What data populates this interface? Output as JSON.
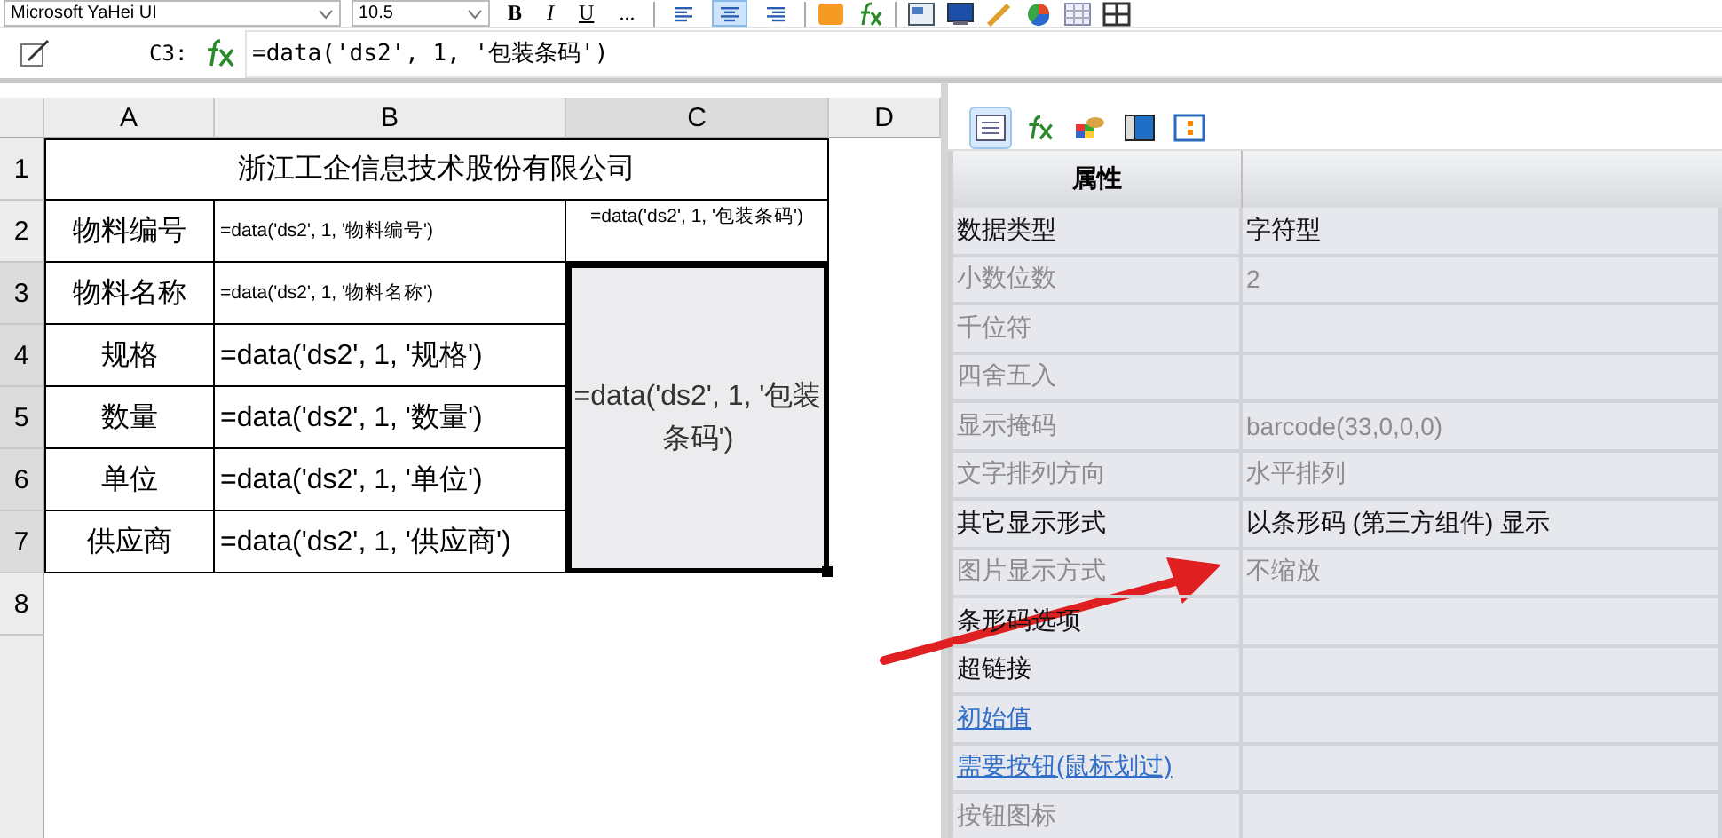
{
  "toolbar": {
    "font": "Microsoft YaHei UI",
    "size": "10.5",
    "format_buttons": [
      {
        "label": "B",
        "kind": "bold"
      },
      {
        "label": "I",
        "kind": "italic"
      },
      {
        "label": "U",
        "kind": "underline"
      },
      {
        "label": "...",
        "kind": "plain"
      }
    ],
    "alignments": [
      {
        "kind": "left",
        "selected": false
      },
      {
        "kind": "center",
        "selected": true
      },
      {
        "kind": "right",
        "selected": false
      }
    ]
  },
  "formula_bar": {
    "cell": "C3:",
    "formula": "=data('ds2', 1, '包装条码')"
  },
  "sheet": {
    "columns": [
      {
        "label": "A",
        "selected": false
      },
      {
        "label": "B",
        "selected": false
      },
      {
        "label": "C",
        "selected": true
      },
      {
        "label": "D",
        "selected": false
      }
    ],
    "rows": [
      {
        "label": "1",
        "selected": false
      },
      {
        "label": "2",
        "selected": false
      },
      {
        "label": "3",
        "selected": true
      },
      {
        "label": "4",
        "selected": true
      },
      {
        "label": "5",
        "selected": true
      },
      {
        "label": "6",
        "selected": true
      },
      {
        "label": "7",
        "selected": true
      },
      {
        "label": "8",
        "selected": false
      }
    ],
    "title_cell": "浙江工企信息技术股份有限公司",
    "field_rows": [
      {
        "label": "物料编号",
        "value": "=data('ds2', 1, '物料编号')",
        "kind": "small"
      },
      {
        "label": "物料名称",
        "value": "=data('ds2', 1, '物料名称')",
        "kind": "small"
      },
      {
        "label": "规格",
        "value": "=data('ds2', 1, '规格')",
        "kind": "large"
      },
      {
        "label": "数量",
        "value": "=data('ds2', 1, '数量')",
        "kind": "large"
      },
      {
        "label": "单位",
        "value": "=data('ds2', 1, '单位')",
        "kind": "large"
      },
      {
        "label": "供应商",
        "value": "=data('ds2', 1, '供应商')",
        "kind": "large"
      }
    ],
    "barcode_header_cell": "=data('ds2', 1, '包装条码')",
    "barcode_cell": {
      "text": "=data('ds2', 1, '包装条码')",
      "selected": true
    }
  },
  "property_panel": {
    "header": "属性",
    "properties": [
      {
        "name": "数据类型",
        "value": "字符型",
        "kind": "normal"
      },
      {
        "name": "小数位数",
        "value": "2",
        "kind": "disabled"
      },
      {
        "name": "千位符",
        "kind": "disabled"
      },
      {
        "name": "四舍五入",
        "kind": "disabled"
      },
      {
        "name": "显示掩码",
        "value": "barcode(33,0,0,0)",
        "kind": "disabled"
      },
      {
        "name": "文字排列方向",
        "value": "水平排列",
        "kind": "disabled"
      },
      {
        "name": "其它显示形式",
        "value": "以条形码 (第三方组件) 显示",
        "kind": "normal"
      },
      {
        "name": "图片显示方式",
        "value": "不缩放",
        "kind": "disabled"
      },
      {
        "name": "条形码选项",
        "kind": "normal"
      },
      {
        "name": "超链接",
        "kind": "normal"
      },
      {
        "name": "初始值",
        "kind": "link"
      },
      {
        "name": "需要按钮(鼠标划过)",
        "kind": "link"
      },
      {
        "name": "按钮图标",
        "kind": "disabled"
      }
    ]
  }
}
